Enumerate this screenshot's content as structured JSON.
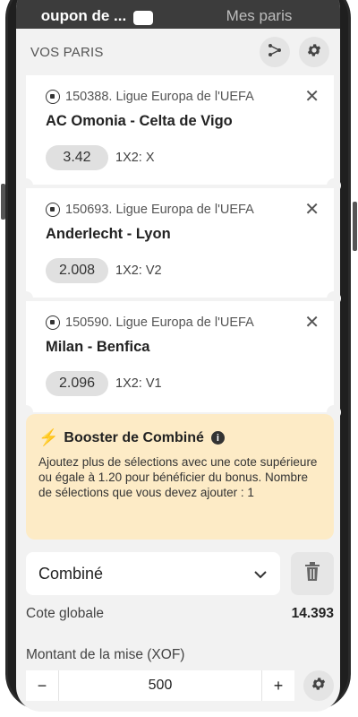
{
  "tabs": [
    {
      "label": "oupon de ..."
    },
    {
      "label": "Mes paris"
    }
  ],
  "header": {
    "title": "VOS PARIS"
  },
  "icons": {
    "share": "share-icon",
    "settings": "gear-icon",
    "close": "close-icon",
    "ball": "soccer-ball-icon",
    "bolt": "lightning-icon",
    "info": "info-icon",
    "chevron": "chevron-down-icon",
    "trash": "trash-icon"
  },
  "bets": [
    {
      "league": "150388. Ligue Europa de l'UEFA",
      "match": "AC Omonia - Celta de Vigo",
      "odds": "3.42",
      "market": "1X2: X"
    },
    {
      "league": "150693. Ligue Europa de l'UEFA",
      "match": "Anderlecht - Lyon",
      "odds": "2.008",
      "market": "1X2: V2"
    },
    {
      "league": "150590. Ligue Europa de l'UEFA",
      "match": "Milan - Benfica",
      "odds": "2.096",
      "market": "1X2: V1"
    }
  ],
  "booster": {
    "title": "Booster de Combiné",
    "text": "Ajoutez plus de sélections avec une cote supérieure ou égale à 1.20 pour bénéficier du bonus. Nombre de sélections que vous devez ajouter : 1",
    "bg_color": "#fdebc6",
    "icon_color": "#f5a623"
  },
  "bet_type": {
    "selected": "Combiné"
  },
  "total_odds": {
    "label": "Cote globale",
    "value": "14.393"
  },
  "stake": {
    "label": "Montant de la mise (XOF)",
    "minus": "−",
    "value": "500",
    "plus": "+"
  }
}
